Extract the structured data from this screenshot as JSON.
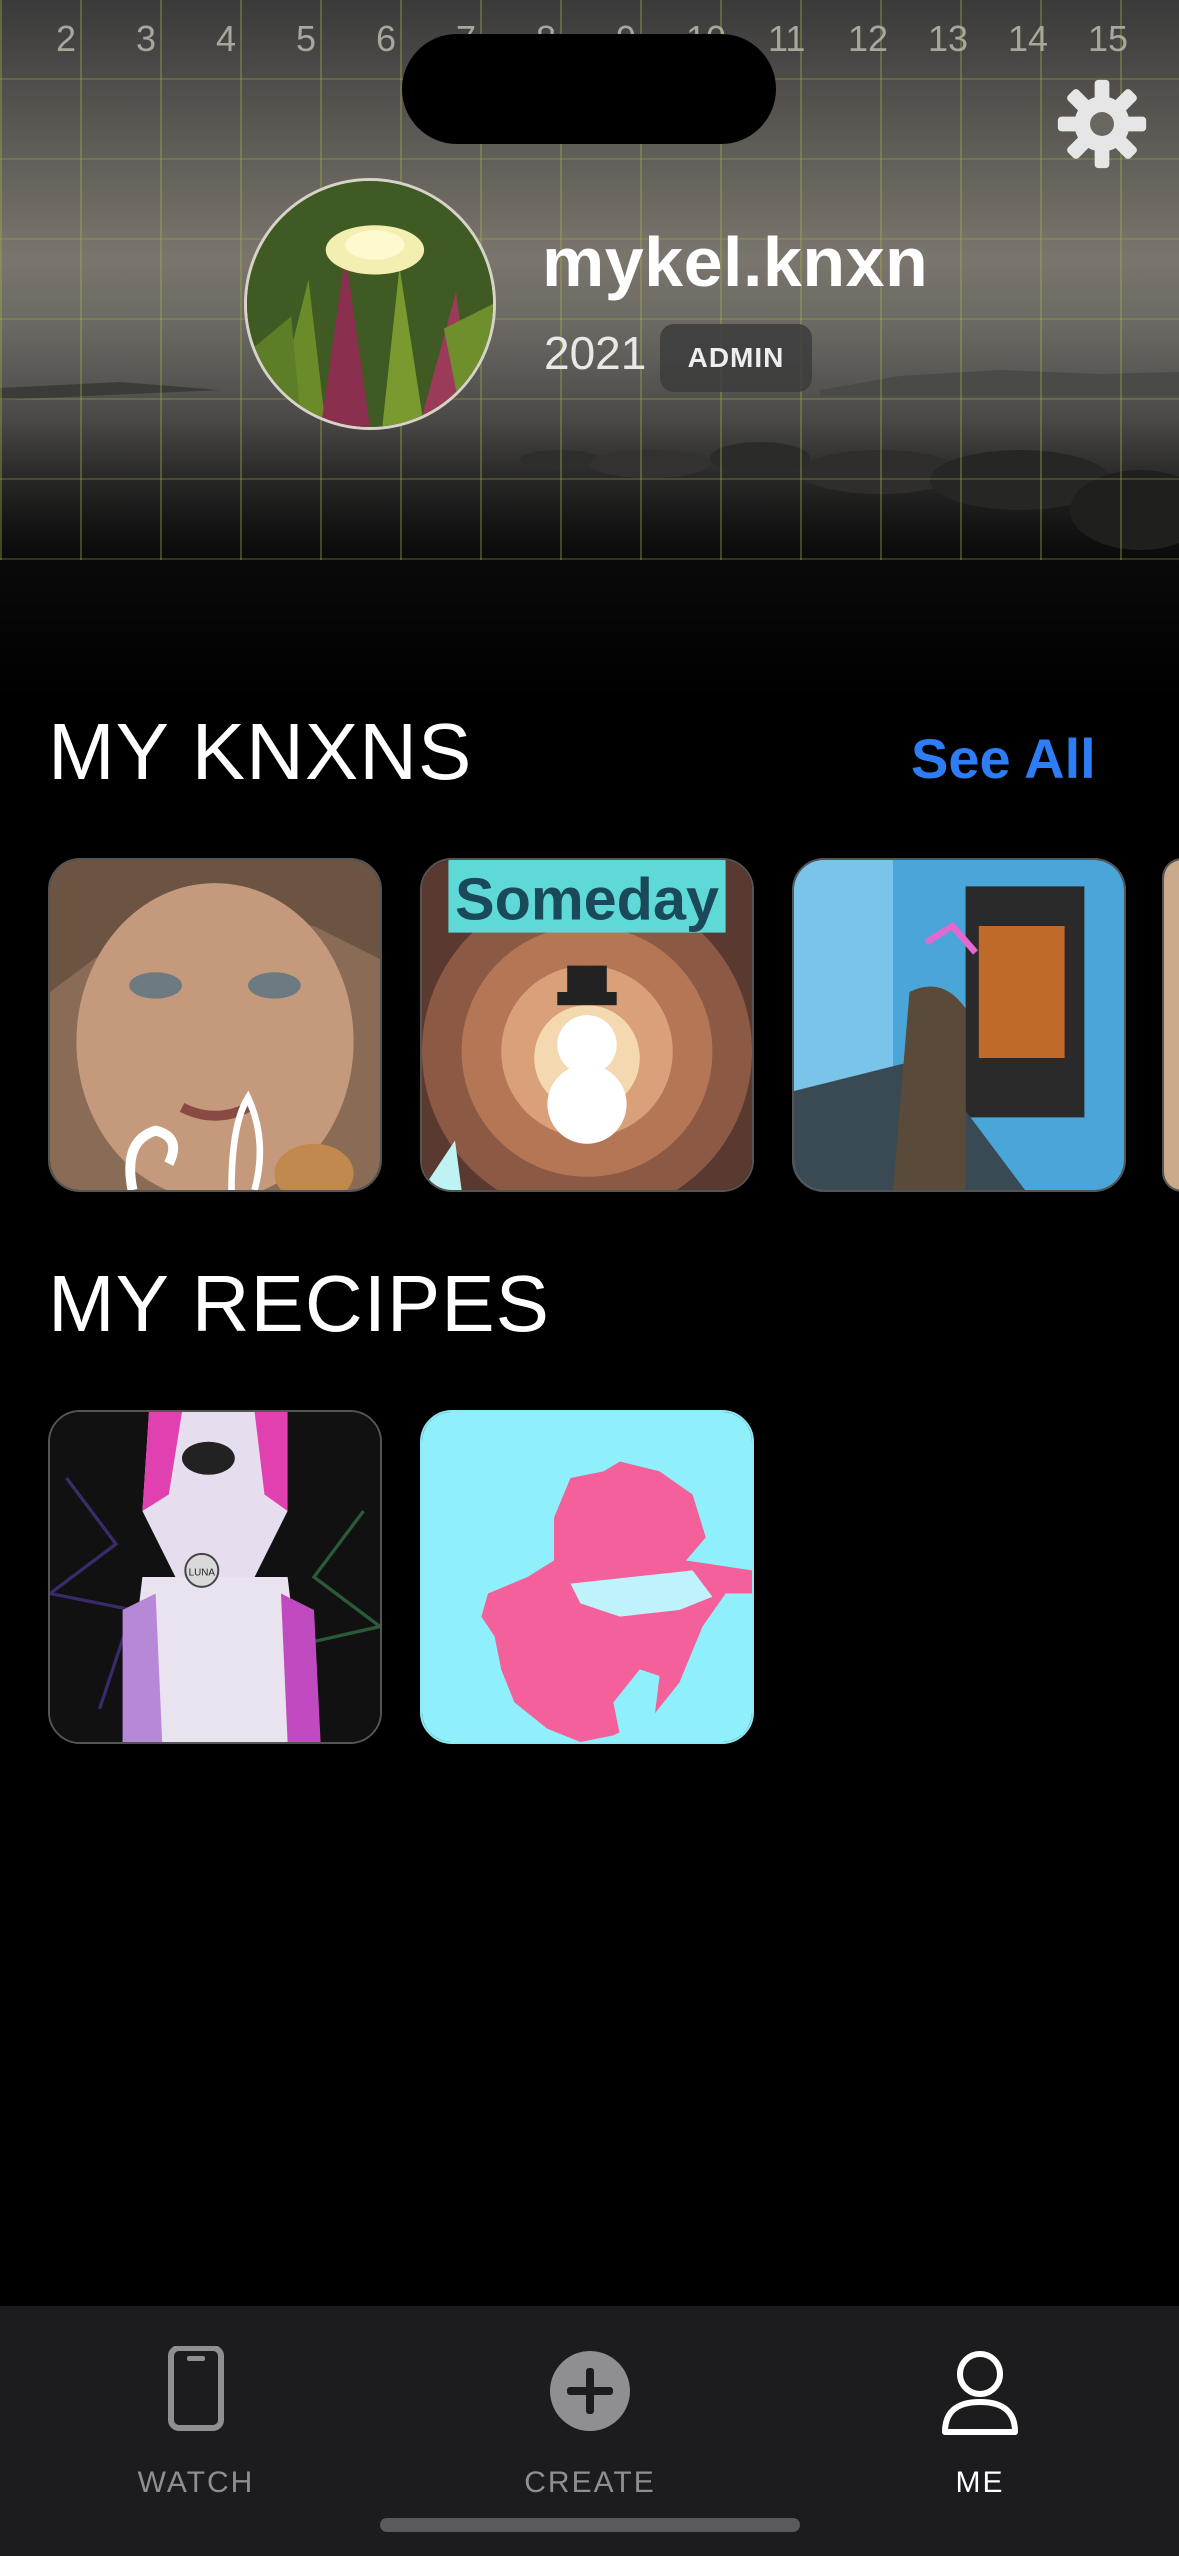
{
  "ruler": {
    "numbers": [
      "2",
      "3",
      "4",
      "5",
      "6",
      "7",
      "8",
      "9",
      "10",
      "11",
      "12",
      "13",
      "14",
      "15"
    ]
  },
  "profile": {
    "username": "mykel.knxn",
    "year": "2021",
    "badge": "ADMIN"
  },
  "sections": {
    "knxns": {
      "title": "MY KNXNS",
      "see_all": "See All"
    },
    "recipes": {
      "title": "MY RECIPES"
    }
  },
  "knxn_tiles": [
    {
      "name": "portrait-woman-thumbnail"
    },
    {
      "name": "someday-snowman-thumbnail",
      "text": "Someday"
    },
    {
      "name": "halftone-room-thumbnail"
    }
  ],
  "recipe_tiles": [
    {
      "name": "dog-pop-art-thumbnail",
      "tag": "LUNA"
    },
    {
      "name": "pink-blob-thumbnail"
    }
  ],
  "tabbar": {
    "watch": "WATCH",
    "create": "CREATE",
    "me": "ME",
    "active": "me"
  },
  "colors": {
    "accent": "#2d7df6",
    "tabbar_bg": "#1c1c1e",
    "inactive": "#8e8e93"
  },
  "icons": [
    "gear-icon",
    "phone-icon",
    "plus-circle-icon",
    "person-icon"
  ]
}
